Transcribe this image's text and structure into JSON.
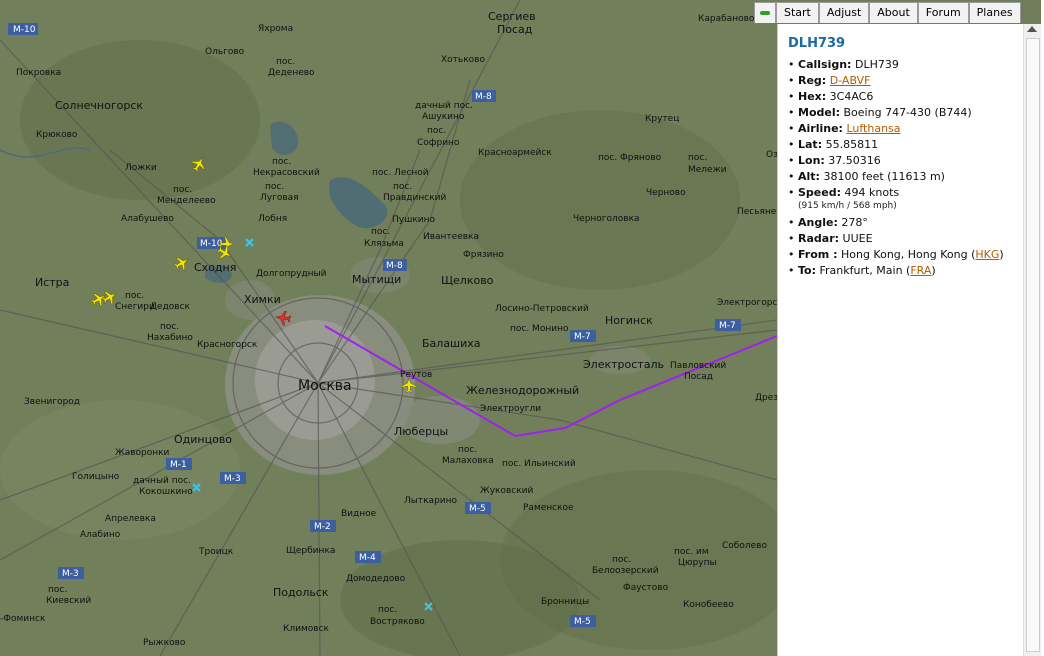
{
  "tabs": [
    "Start",
    "Adjust",
    "About",
    "Forum",
    "Planes"
  ],
  "flight": {
    "title": "DLH739",
    "callsign": {
      "label": "Callsign:",
      "value": "DLH739"
    },
    "reg": {
      "label": "Reg:",
      "value": "D-ABVF"
    },
    "hex": {
      "label": "Hex:",
      "value": "3C4AC6"
    },
    "model": {
      "label": "Model:",
      "value": "Boeing 747-430 (B744)"
    },
    "airline": {
      "label": "Airline:",
      "value": "Lufthansa"
    },
    "lat": {
      "label": "Lat:",
      "value": "55.85811"
    },
    "lon": {
      "label": "Lon:",
      "value": "37.50316"
    },
    "alt": {
      "label": "Alt:",
      "value": "38100 feet (11613 m)"
    },
    "speed": {
      "label": "Speed:",
      "value": "494 knots",
      "sub": "(915 km/h / 568 mph)"
    },
    "angle": {
      "label": "Angle:",
      "value": "278°"
    },
    "radar": {
      "label": "Radar:",
      "value": "UUEE"
    },
    "from": {
      "label": "From :",
      "value": "Hong Kong, Hong Kong (",
      "code": "HKG",
      "close": ")"
    },
    "to": {
      "label": "To:",
      "value": "Frankfurt, Main (",
      "code": "FRA",
      "close": ")"
    }
  },
  "map": {
    "labels": {
      "moscow": "Москва",
      "sergiev": "Сергиев",
      "posad": "Посад",
      "karabanovo": "Карабаново",
      "yakhroma": "Яхрома",
      "pokrovka": "Покровка",
      "olgovo": "Ольгово",
      "pos1": "пос.",
      "dedenevo": "Деденево",
      "hotkovo": "Хотьково",
      "ashukino_a": "дачный пос.",
      "ashukino": "Ашукино",
      "solnechnogorsk": "Солнечногорск",
      "kryukovo": "Крюково",
      "kruttsy": "Крутец",
      "sofrino_a": "пос.",
      "sofrino": "Софрино",
      "krasnoarmeysk": "Красноармейск",
      "lozhki": "Ложки",
      "nekrasovskiy_a": "пос.",
      "nekrasovskiy": "Некрасовский",
      "lesnoy": "пос. Лесной",
      "peresvet": "пос. Фряново",
      "pos_ok": "пос.",
      "meleshi": "Мележи",
      "mendeleevo_a": "пос.",
      "mendeleevo": "Менделеево",
      "lugovaya_a": "пос.",
      "lugovaya": "Луговая",
      "pravdinsky_a": "пос.",
      "pravdinsky": "Правдинский",
      "chernovo": "Черново",
      "alabushevo": "Алабушево",
      "lobnya": "Лобня",
      "pushkino": "Пушкино",
      "chernogolovka": "Черноголовка",
      "peseln": "Песьяне",
      "klyazma_a": "пос.",
      "klyazma": "Клязьма",
      "ivanteevka": "Ивантеевка",
      "skhodnya": "Сходня",
      "dolgoprudny": "Долгопрудный",
      "fryazino": "Фрязино",
      "istra": "Истра",
      "mytishchi": "Мытищи",
      "shchelkovo": "Щелково",
      "elektrogorsk": "Электрогорс",
      "snegiri_a": "пос.",
      "snegiri": "Снегири",
      "khimki": "Химки",
      "losino": "Лосино-Петровский",
      "dedovsk": "Дедовск",
      "noginsk": "Ногинск",
      "nakhabino_a": "пос.",
      "nakhabino": "Нахабино",
      "monino": "пос. Монино",
      "krasnogorsk": "Красногорск",
      "balashikha": "Балашиха",
      "elektrostal": "Электросталь",
      "pavlovsky": "Павловский",
      "posad2": "Посад",
      "reutov": "Реутов",
      "zheleznodorozhny": "Железнодорожный",
      "zvenigorod": "Звенигород",
      "elektrougli": "Электроугли",
      "dreznya": "Дрез",
      "odintsovo": "Одинцово",
      "lyubertsy": "Люберцы",
      "zhavoronki": "Жаворонки",
      "malakhovka_a": "пос.",
      "malakhovka": "Малаховка",
      "ilinsky": "пос. Ильинский",
      "golitsyno": "Голицыно",
      "kokoshkino_a": "дачный пос.",
      "kokoshkino": "Кокошкино",
      "zhukovsky": "Жуковский",
      "lytkarino": "Лыткарино",
      "ramenskoe": "Раменское",
      "aprelevka": "Апрелевка",
      "vidnoe": "Видное",
      "sobolevo": "Соболево",
      "alabino": "Алабино",
      "troitsk": "Троицк",
      "shcherbinka": "Щербинка",
      "yurupa_a": "пос. им",
      "yurupa": "Цюрупы",
      "domodedovo": "Домодедово",
      "belooz_a": "пос.",
      "belooz": "Белоозерский",
      "faustovo": "Фаустово",
      "podolsk": "Подольск",
      "kievsky_a": "пос.",
      "kievsky": "Киевский",
      "bronnitsy": "Бронницы",
      "konobeevo": "Конобеево",
      "klimovsk": "Климовск",
      "vostryakovo_a": "пос.",
      "vostryakovo": "Востряково",
      "fominsk": "-Фоминск",
      "ryzhkovo": "Рыжково",
      "oz": "Оз"
    },
    "roads": [
      "M-10",
      "M-8",
      "M-8",
      "M-10",
      "M-7",
      "M-7",
      "M-1",
      "M-3",
      "M-2",
      "M-4",
      "M-5",
      "M-5",
      "M-3"
    ]
  }
}
